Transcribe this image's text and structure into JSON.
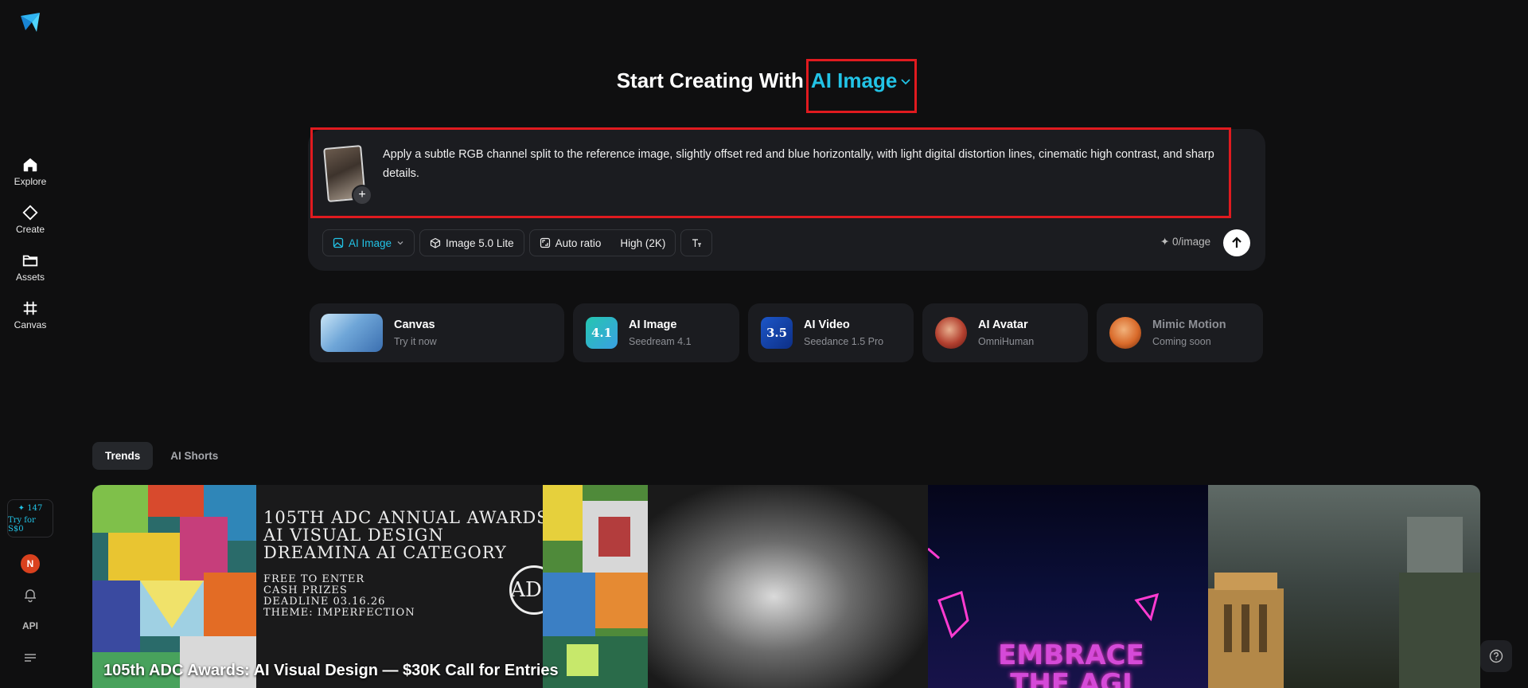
{
  "sidebar": {
    "items": [
      {
        "label": "Explore",
        "icon": "home-icon"
      },
      {
        "label": "Create",
        "icon": "diamond-icon"
      },
      {
        "label": "Assets",
        "icon": "folder-icon"
      },
      {
        "label": "Canvas",
        "icon": "frame-icon"
      }
    ],
    "credits": "✦ 147",
    "try_label": "Try for S$0",
    "avatar_initial": "N",
    "api_label": "API"
  },
  "heading": {
    "prefix": "Start Creating With",
    "mode": "AI Image"
  },
  "prompt": {
    "text": "Apply a subtle RGB channel split to the reference image, slightly offset red and blue horizontally, with light digital distortion lines, cinematic high contrast, and sharp details."
  },
  "toolbar": {
    "mode_label": "AI Image",
    "model_label": "Image 5.0 Lite",
    "ratio_label": "Auto ratio",
    "quality_label": "High (2K)",
    "cost_label": "✦ 0/image"
  },
  "cards": [
    {
      "title": "Canvas",
      "subtitle": "Try it now"
    },
    {
      "title": "AI Image",
      "subtitle": "Seedream 4.1",
      "badge": "4.1"
    },
    {
      "title": "AI Video",
      "subtitle": "Seedance 1.5 Pro",
      "badge": "3.5"
    },
    {
      "title": "AI Avatar",
      "subtitle": "OmniHuman"
    },
    {
      "title": "Mimic Motion",
      "subtitle": "Coming soon"
    }
  ],
  "tabs": [
    {
      "label": "Trends",
      "active": true
    },
    {
      "label": "AI Shorts",
      "active": false
    }
  ],
  "gallery": {
    "adc": {
      "line1": "105TH ADC ANNUAL AWARDS",
      "line2": "AI VISUAL DESIGN",
      "line3": "DREAMINA AI CATEGORY",
      "small1": "FREE TO ENTER",
      "small2": "CASH PRIZES",
      "small3": "DEADLINE 03.16.26",
      "small4": "THEME: IMPERFECTION",
      "caption": "105th ADC Awards: AI Visual Design — $30K Call for Entries"
    },
    "retro_text": "EMBRACE THE AGI"
  },
  "colors": {
    "accent": "#22c3e6",
    "highlight": "#e01a1f",
    "background": "#0f0f10",
    "panel": "#1b1c20"
  }
}
